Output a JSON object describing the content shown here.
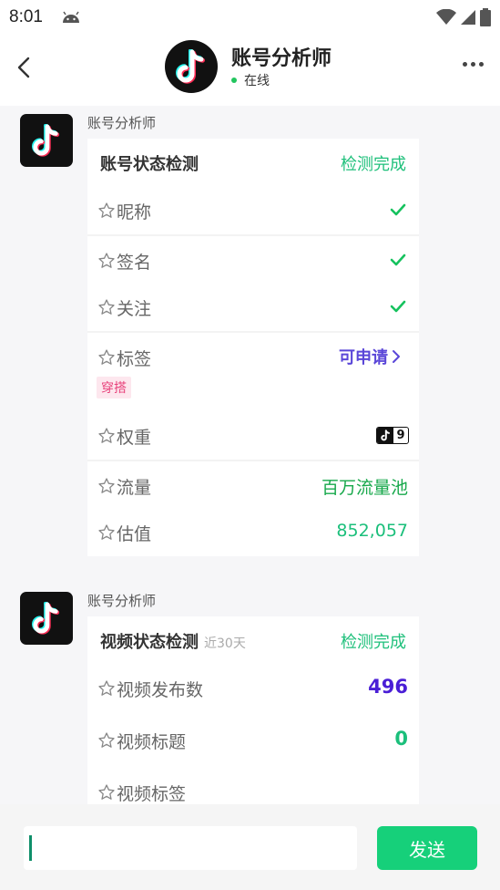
{
  "status_bar": {
    "time": "8:01"
  },
  "header": {
    "title": "账号分析师",
    "status": "在线"
  },
  "messages": [
    {
      "sender": "账号分析师",
      "card": {
        "title": "账号状态检测",
        "status": "检测完成",
        "rows": {
          "nickname": {
            "label": "昵称"
          },
          "signature": {
            "label": "签名"
          },
          "follow": {
            "label": "关注"
          },
          "tags": {
            "label": "标签",
            "action": "可申请",
            "tag": "穿搭"
          },
          "weight": {
            "label": "权重",
            "badge_number": "9"
          },
          "traffic": {
            "label": "流量",
            "value": "百万流量池"
          },
          "valuation": {
            "label": "估值",
            "value": "852,057"
          }
        }
      }
    },
    {
      "sender": "账号分析师",
      "card": {
        "title": "视频状态检测",
        "subtitle": "近30天",
        "status": "检测完成",
        "rows": {
          "video_count": {
            "label": "视频发布数",
            "value": "496"
          },
          "video_titles": {
            "label": "视频标题",
            "value": "0"
          },
          "video_tags": {
            "label": "视频标签"
          }
        }
      }
    }
  ],
  "composer": {
    "send_label": "发送"
  },
  "colors": {
    "accent_green": "#16d07a",
    "detect_green": "#1fc07b",
    "purple": "#4a1ed6",
    "tag_pink": "#e8437c"
  },
  "icons": [
    "back-arrow-icon",
    "more-dots-icon",
    "star-outline-icon",
    "checkmark-icon",
    "chevron-right-icon",
    "tiktok-logo-icon",
    "wifi-icon",
    "cell-signal-icon",
    "battery-icon",
    "android-icon"
  ]
}
